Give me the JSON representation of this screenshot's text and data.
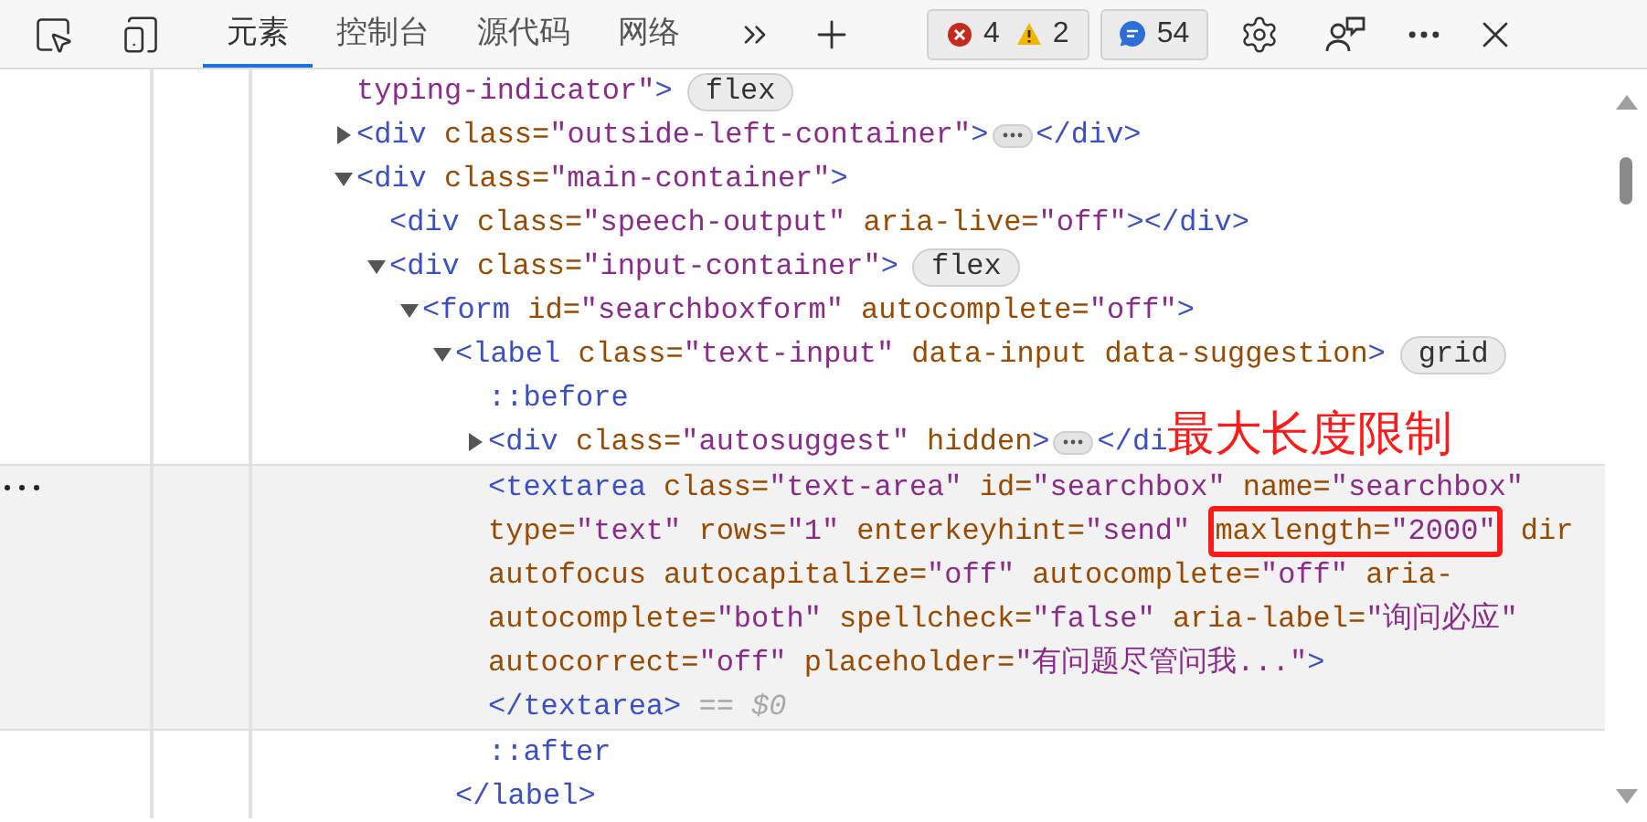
{
  "toolbar": {
    "tabs": [
      {
        "label": "元素",
        "selected": true
      },
      {
        "label": "控制台",
        "selected": false
      },
      {
        "label": "源代码",
        "selected": false
      },
      {
        "label": "网络",
        "selected": false
      }
    ],
    "issue_counts": [
      {
        "kind": "error",
        "count": "4"
      },
      {
        "kind": "warning",
        "count": "2"
      }
    ],
    "message_count": {
      "kind": "info",
      "count": "54"
    }
  },
  "tree": [
    {
      "selected": false,
      "lines": [
        [
          {
            "kind": "val",
            "text": "typing-indicator\""
          },
          {
            "kind": "tag",
            "text": ">"
          },
          {
            "kind": "pill",
            "text": "flex"
          }
        ]
      ]
    },
    {
      "selected": false,
      "expanded": false,
      "lines": [
        [
          {
            "kind": "tag",
            "text": "<div"
          },
          {
            "kind": "attr",
            "text": " class="
          },
          {
            "kind": "val",
            "text": "\"outside-left-container\""
          },
          {
            "kind": "tag",
            "text": ">"
          },
          {
            "kind": "ellipsis"
          },
          {
            "kind": "tag",
            "text": "</div>"
          }
        ]
      ]
    },
    {
      "selected": false,
      "expanded": true,
      "lines": [
        [
          {
            "kind": "tag",
            "text": "<div"
          },
          {
            "kind": "attr",
            "text": " class="
          },
          {
            "kind": "val",
            "text": "\"main-container\""
          },
          {
            "kind": "tag",
            "text": ">"
          }
        ]
      ],
      "children": [
        {
          "selected": false,
          "lines": [
            [
              {
                "kind": "tag",
                "text": "<div"
              },
              {
                "kind": "attr",
                "text": " class="
              },
              {
                "kind": "val",
                "text": "\"speech-output\""
              },
              {
                "kind": "attr",
                "text": " aria-live="
              },
              {
                "kind": "val",
                "text": "\"off\""
              },
              {
                "kind": "tag",
                "text": "></div>"
              }
            ]
          ]
        },
        {
          "selected": false,
          "expanded": true,
          "lines": [
            [
              {
                "kind": "tag",
                "text": "<div"
              },
              {
                "kind": "attr",
                "text": " class="
              },
              {
                "kind": "val",
                "text": "\"input-container\""
              },
              {
                "kind": "tag",
                "text": ">"
              },
              {
                "kind": "pill",
                "text": "flex"
              }
            ]
          ],
          "children": [
            {
              "selected": false,
              "expanded": true,
              "lines": [
                [
                  {
                    "kind": "tag",
                    "text": "<form"
                  },
                  {
                    "kind": "attr",
                    "text": " id="
                  },
                  {
                    "kind": "val",
                    "text": "\"searchboxform\""
                  },
                  {
                    "kind": "attr",
                    "text": " autocomplete="
                  },
                  {
                    "kind": "val",
                    "text": "\"off\""
                  },
                  {
                    "kind": "tag",
                    "text": ">"
                  }
                ]
              ],
              "children": [
                {
                  "selected": false,
                  "expanded": true,
                  "lines": [
                    [
                      {
                        "kind": "tag",
                        "text": "<label"
                      },
                      {
                        "kind": "attr",
                        "text": " class="
                      },
                      {
                        "kind": "val",
                        "text": "\"text-input\""
                      },
                      {
                        "kind": "attr",
                        "text": " data-input data-suggestion"
                      },
                      {
                        "kind": "tag",
                        "text": ">"
                      },
                      {
                        "kind": "pill",
                        "text": "grid"
                      }
                    ]
                  ],
                  "closing": [
                    [
                      {
                        "kind": "tag",
                        "text": "</label>"
                      }
                    ]
                  ],
                  "children": [
                    {
                      "selected": false,
                      "lines": [
                        [
                          {
                            "kind": "tag",
                            "text": "::before"
                          }
                        ]
                      ]
                    },
                    {
                      "selected": false,
                      "expanded": false,
                      "lines": [
                        [
                          {
                            "kind": "tag",
                            "text": "<div"
                          },
                          {
                            "kind": "attr",
                            "text": " class="
                          },
                          {
                            "kind": "val",
                            "text": "\"autosuggest\""
                          },
                          {
                            "kind": "attr",
                            "text": " hidden"
                          },
                          {
                            "kind": "tag",
                            "text": ">"
                          },
                          {
                            "kind": "ellipsis"
                          },
                          {
                            "kind": "tag",
                            "text": "</di"
                          },
                          {
                            "kind": "note",
                            "text": "最大长度限制"
                          }
                        ]
                      ]
                    },
                    {
                      "selected": true,
                      "lines": [
                        [
                          {
                            "kind": "tag",
                            "text": "<textarea"
                          },
                          {
                            "kind": "attr",
                            "text": " class="
                          },
                          {
                            "kind": "val",
                            "text": "\"text-area\""
                          },
                          {
                            "kind": "attr",
                            "text": " id="
                          },
                          {
                            "kind": "val",
                            "text": "\"searchbox\""
                          },
                          {
                            "kind": "attr",
                            "text": " name="
                          },
                          {
                            "kind": "val",
                            "text": "\"searchbox\""
                          }
                        ],
                        [
                          {
                            "kind": "attr",
                            "text": "type="
                          },
                          {
                            "kind": "val",
                            "text": "\"text\""
                          },
                          {
                            "kind": "attr",
                            "text": " rows="
                          },
                          {
                            "kind": "val",
                            "text": "\"1\""
                          },
                          {
                            "kind": "attr",
                            "text": " enterkeyhint="
                          },
                          {
                            "kind": "val",
                            "text": "\"send\" "
                          },
                          {
                            "kind": "group",
                            "boxed": true,
                            "parts": [
                              {
                                "kind": "attr",
                                "text": "maxlength="
                              },
                              {
                                "kind": "val",
                                "text": "\"2000\""
                              }
                            ]
                          },
                          {
                            "kind": "attr",
                            "text": " dir"
                          }
                        ],
                        [
                          {
                            "kind": "attr",
                            "text": "autofocus autocapitalize="
                          },
                          {
                            "kind": "val",
                            "text": "\"off\""
                          },
                          {
                            "kind": "attr",
                            "text": " autocomplete="
                          },
                          {
                            "kind": "val",
                            "text": "\"off\""
                          },
                          {
                            "kind": "attr",
                            "text": " aria-"
                          }
                        ],
                        [
                          {
                            "kind": "attr",
                            "text": "autocomplete="
                          },
                          {
                            "kind": "val",
                            "text": "\"both\""
                          },
                          {
                            "kind": "attr",
                            "text": " spellcheck="
                          },
                          {
                            "kind": "val",
                            "text": "\"false\""
                          },
                          {
                            "kind": "attr",
                            "text": " aria-label="
                          },
                          {
                            "kind": "val",
                            "text": "\"询问必应\""
                          }
                        ],
                        [
                          {
                            "kind": "attr",
                            "text": "autocorrect="
                          },
                          {
                            "kind": "val",
                            "text": "\"off\""
                          },
                          {
                            "kind": "attr",
                            "text": " placeholder="
                          },
                          {
                            "kind": "val",
                            "text": "\"有问题尽管问我...\""
                          },
                          {
                            "kind": "tag",
                            "text": ">"
                          }
                        ],
                        [
                          {
                            "kind": "tag",
                            "text": "</textarea>"
                          },
                          {
                            "kind": "ref",
                            "text": " == $0"
                          }
                        ]
                      ]
                    },
                    {
                      "selected": false,
                      "lines": [
                        [
                          {
                            "kind": "tag",
                            "text": "::after"
                          }
                        ]
                      ]
                    }
                  ]
                }
              ]
            }
          ]
        }
      ]
    }
  ]
}
